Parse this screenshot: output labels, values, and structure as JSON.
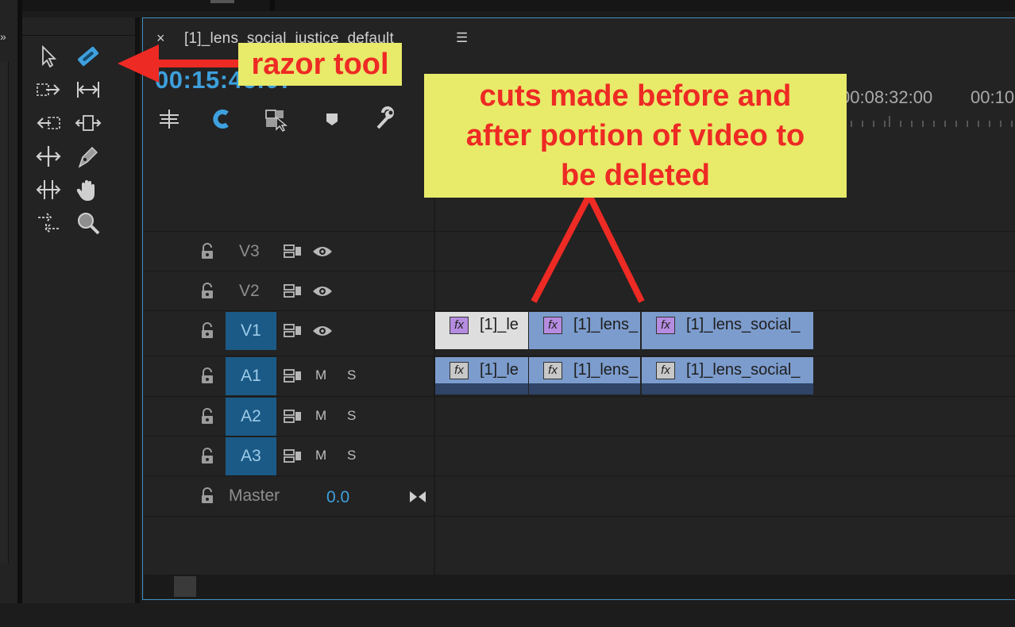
{
  "timeline": {
    "close_glyph": "×",
    "title": "[1]_lens_social_justice_default",
    "menu_glyph": "☰",
    "timecode": "00:15:46:07",
    "ruler_labels": [
      "00:08:32:00",
      "00:10"
    ]
  },
  "tracks": [
    {
      "id": "v3",
      "label": "V3",
      "kind": "video",
      "targeted": false
    },
    {
      "id": "v2",
      "label": "V2",
      "kind": "video",
      "targeted": false
    },
    {
      "id": "v1",
      "label": "V1",
      "kind": "video",
      "targeted": true
    },
    {
      "id": "a1",
      "label": "A1",
      "kind": "audio",
      "targeted": true,
      "mute": "M",
      "solo": "S"
    },
    {
      "id": "a2",
      "label": "A2",
      "kind": "audio",
      "targeted": true,
      "mute": "M",
      "solo": "S"
    },
    {
      "id": "a3",
      "label": "A3",
      "kind": "audio",
      "targeted": true,
      "mute": "M",
      "solo": "S"
    }
  ],
  "master": {
    "label": "Master",
    "value": "0.0"
  },
  "clips": {
    "v1": [
      {
        "fx": "fx",
        "name": "[1]_le",
        "selected": false
      },
      {
        "fx": "fx",
        "name": "[1]_lens_",
        "selected": true
      },
      {
        "fx": "fx",
        "name": "[1]_lens_social_",
        "selected": true
      }
    ],
    "a1": [
      {
        "fx": "fx",
        "name": "[1]_le"
      },
      {
        "fx": "fx",
        "name": "[1]_lens_"
      },
      {
        "fx": "fx",
        "name": "[1]_lens_social_"
      }
    ]
  },
  "tools": [
    "selection-tool-icon",
    "razor-tool-icon",
    "track-select-forward-icon",
    "ripple-edit-icon",
    "track-select-backward-icon",
    "rolling-edit-icon",
    "slip-tool-icon",
    "pen-tool-icon",
    "slide-tool-icon",
    "hand-tool-icon",
    "rate-stretch-icon",
    "zoom-tool-icon"
  ],
  "annotations": {
    "razor_label": "razor tool",
    "cuts_lines": [
      "cuts made before and",
      "after portion of video to",
      "be deleted"
    ]
  },
  "colors": {
    "accent_blue": "#3ea0dd",
    "target_blue": "#1b5a86",
    "clip_blue": "#7c9ccd",
    "clip_white": "#dedede",
    "annotation_yellow": "#e8ea6a",
    "annotation_red": "#ee2a24"
  }
}
